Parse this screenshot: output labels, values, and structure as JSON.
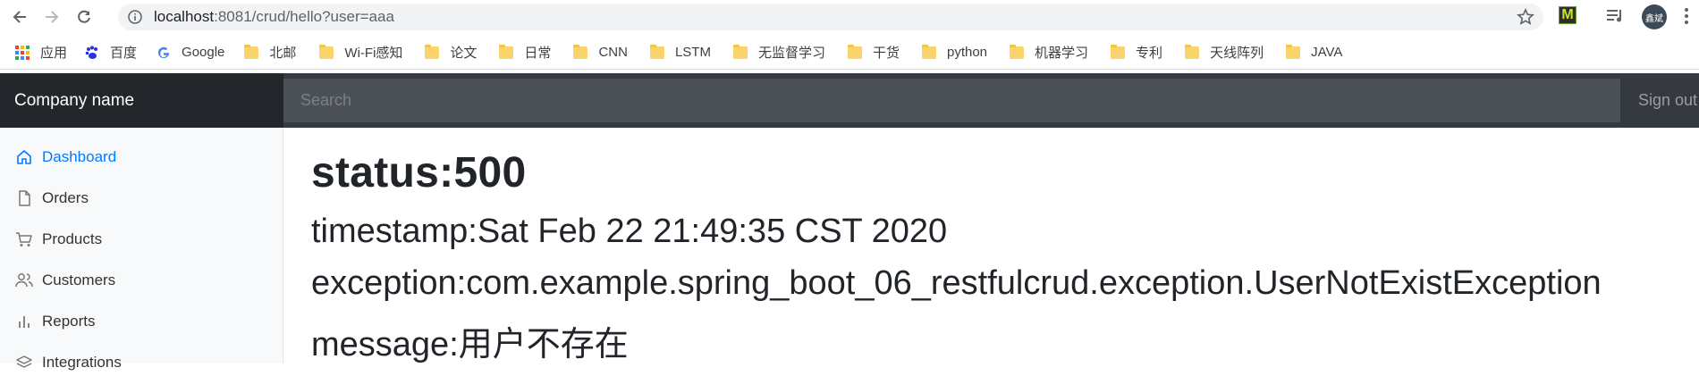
{
  "browser": {
    "url_host": "localhost",
    "url_path": ":8081/crud/hello?user=aaa",
    "avatar_label": "鑫斌",
    "bookmarks": [
      {
        "label": "应用",
        "icon": "apps-grid-icon"
      },
      {
        "label": "百度",
        "icon": "baidu-paw-icon"
      },
      {
        "label": "Google",
        "icon": "google-g-icon"
      },
      {
        "label": "北邮",
        "icon": "folder-icon"
      },
      {
        "label": "Wi-Fi感知",
        "icon": "folder-icon"
      },
      {
        "label": "论文",
        "icon": "folder-icon"
      },
      {
        "label": "日常",
        "icon": "folder-icon"
      },
      {
        "label": "CNN",
        "icon": "folder-icon"
      },
      {
        "label": "LSTM",
        "icon": "folder-icon"
      },
      {
        "label": "无监督学习",
        "icon": "folder-icon"
      },
      {
        "label": "干货",
        "icon": "folder-icon"
      },
      {
        "label": "python",
        "icon": "folder-icon"
      },
      {
        "label": "机器学习",
        "icon": "folder-icon"
      },
      {
        "label": "专利",
        "icon": "folder-icon"
      },
      {
        "label": "天线阵列",
        "icon": "folder-icon"
      },
      {
        "label": "JAVA",
        "icon": "folder-icon"
      }
    ]
  },
  "navbar": {
    "brand": "Company name",
    "search_placeholder": "Search",
    "signout": "Sign out"
  },
  "sidebar": {
    "items": [
      {
        "label": "Dashboard",
        "icon": "home-icon",
        "active": true
      },
      {
        "label": "Orders",
        "icon": "file-icon"
      },
      {
        "label": "Products",
        "icon": "shopping-cart-icon"
      },
      {
        "label": "Customers",
        "icon": "users-icon"
      },
      {
        "label": "Reports",
        "icon": "bar-chart-icon"
      },
      {
        "label": "Integrations",
        "icon": "layers-icon"
      }
    ]
  },
  "error": {
    "status": "status:500",
    "timestamp": "timestamp:Sat Feb 22 21:49:35 CST 2020",
    "exception": "exception:com.example.spring_boot_06_restfulcrud.exception.UserNotExistException",
    "message": "message:用户不存在"
  },
  "colors": {
    "navbar_bg": "#343a40",
    "brand_bg": "#23272b",
    "active_link": "#007bff",
    "sidebar_bg": "#f8f9fa"
  }
}
